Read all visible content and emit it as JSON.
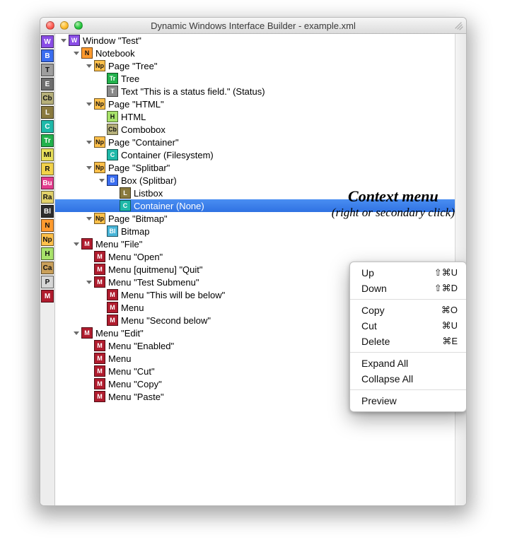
{
  "window": {
    "title": "Dynamic Windows Interface Builder - example.xml"
  },
  "annotation": {
    "line1": "Context menu",
    "line2": "(right or secondary click)"
  },
  "toolbox": [
    {
      "code": "W",
      "color": "#8a4de6",
      "dark": true
    },
    {
      "code": "B",
      "color": "#3a6df0",
      "dark": true
    },
    {
      "code": "T",
      "color": "#9e9e9e"
    },
    {
      "code": "E",
      "color": "#6e6e6e",
      "dark": true
    },
    {
      "code": "Cb",
      "color": "#b6b07a"
    },
    {
      "code": "L",
      "color": "#8a7a3e",
      "dark": true
    },
    {
      "code": "C",
      "color": "#1fb9a9",
      "dark": true
    },
    {
      "code": "Tr",
      "color": "#22b14c",
      "dark": true
    },
    {
      "code": "Ml",
      "color": "#e8e05a"
    },
    {
      "code": "R",
      "color": "#f2d24a"
    },
    {
      "code": "Bu",
      "color": "#e23b8d",
      "dark": true
    },
    {
      "code": "Ra",
      "color": "#e2d26a"
    },
    {
      "code": "Bl",
      "color": "#2e2e2e",
      "dark": true
    },
    {
      "code": "N",
      "color": "#ff9a2e"
    },
    {
      "code": "Np",
      "color": "#ffc04a"
    },
    {
      "code": "H",
      "color": "#a8e26a"
    },
    {
      "code": "Ca",
      "color": "#caa05a"
    },
    {
      "code": "P",
      "color": "#d6d6d6"
    },
    {
      "code": "M",
      "color": "#b01c2e",
      "dark": true
    }
  ],
  "icon_palette": {
    "W": {
      "color": "#8a4de6",
      "dark": true
    },
    "N": {
      "color": "#ff9a2e"
    },
    "Np": {
      "color": "#ffc04a"
    },
    "Tr": {
      "color": "#22b14c",
      "dark": true
    },
    "T": {
      "color": "#8a8a8a",
      "dark": true
    },
    "H": {
      "color": "#a8e26a"
    },
    "Cb": {
      "color": "#b6b07a"
    },
    "C": {
      "color": "#1fb9a9",
      "dark": true
    },
    "B": {
      "color": "#3a6df0",
      "dark": true
    },
    "L": {
      "color": "#8a7a3e",
      "dark": true
    },
    "Bl": {
      "color": "#48b5d8",
      "dark": true
    },
    "M": {
      "color": "#b01c2e",
      "dark": true
    }
  },
  "tree": [
    {
      "depth": 0,
      "icon": "W",
      "label": "Window \"Test\"",
      "disc": "open"
    },
    {
      "depth": 1,
      "icon": "N",
      "label": "Notebook",
      "disc": "open"
    },
    {
      "depth": 2,
      "icon": "Np",
      "label": "Page \"Tree\"",
      "disc": "open"
    },
    {
      "depth": 3,
      "icon": "Tr",
      "label": "Tree"
    },
    {
      "depth": 3,
      "icon": "T",
      "label": "Text \"This is a status field.\" (Status)"
    },
    {
      "depth": 2,
      "icon": "Np",
      "label": "Page \"HTML\"",
      "disc": "open"
    },
    {
      "depth": 3,
      "icon": "H",
      "label": "HTML"
    },
    {
      "depth": 3,
      "icon": "Cb",
      "label": "Combobox"
    },
    {
      "depth": 2,
      "icon": "Np",
      "label": "Page \"Container\"",
      "disc": "open"
    },
    {
      "depth": 3,
      "icon": "C",
      "label": "Container (Filesystem)"
    },
    {
      "depth": 2,
      "icon": "Np",
      "label": "Page \"Splitbar\"",
      "disc": "open"
    },
    {
      "depth": 3,
      "icon": "B",
      "label": "Box (Splitbar)",
      "disc": "open"
    },
    {
      "depth": 4,
      "icon": "L",
      "label": "Listbox"
    },
    {
      "depth": 4,
      "icon": "C",
      "label": "Container (None)",
      "selected": true
    },
    {
      "depth": 2,
      "icon": "Np",
      "label": "Page \"Bitmap\"",
      "disc": "open"
    },
    {
      "depth": 3,
      "icon": "Bl",
      "label": "Bitmap"
    },
    {
      "depth": 1,
      "icon": "M",
      "label": "Menu \"File\"",
      "disc": "open"
    },
    {
      "depth": 2,
      "icon": "M",
      "label": "Menu \"Open\""
    },
    {
      "depth": 2,
      "icon": "M",
      "label": "Menu [quitmenu] \"Quit\""
    },
    {
      "depth": 2,
      "icon": "M",
      "label": "Menu \"Test Submenu\"",
      "disc": "open"
    },
    {
      "depth": 3,
      "icon": "M",
      "label": "Menu \"This will be below\""
    },
    {
      "depth": 3,
      "icon": "M",
      "label": "Menu"
    },
    {
      "depth": 3,
      "icon": "M",
      "label": "Menu \"Second below\""
    },
    {
      "depth": 1,
      "icon": "M",
      "label": "Menu \"Edit\"",
      "disc": "open"
    },
    {
      "depth": 2,
      "icon": "M",
      "label": "Menu \"Enabled\""
    },
    {
      "depth": 2,
      "icon": "M",
      "label": "Menu"
    },
    {
      "depth": 2,
      "icon": "M",
      "label": "Menu \"Cut\""
    },
    {
      "depth": 2,
      "icon": "M",
      "label": "Menu \"Copy\""
    },
    {
      "depth": 2,
      "icon": "M",
      "label": "Menu \"Paste\""
    }
  ],
  "context_menu": {
    "groups": [
      [
        {
          "label": "Up",
          "shortcut": "⇧⌘U"
        },
        {
          "label": "Down",
          "shortcut": "⇧⌘D"
        }
      ],
      [
        {
          "label": "Copy",
          "shortcut": "⌘O"
        },
        {
          "label": "Cut",
          "shortcut": "⌘U"
        },
        {
          "label": "Delete",
          "shortcut": "⌘E"
        }
      ],
      [
        {
          "label": "Expand All"
        },
        {
          "label": "Collapse All"
        }
      ],
      [
        {
          "label": "Preview"
        }
      ]
    ]
  }
}
